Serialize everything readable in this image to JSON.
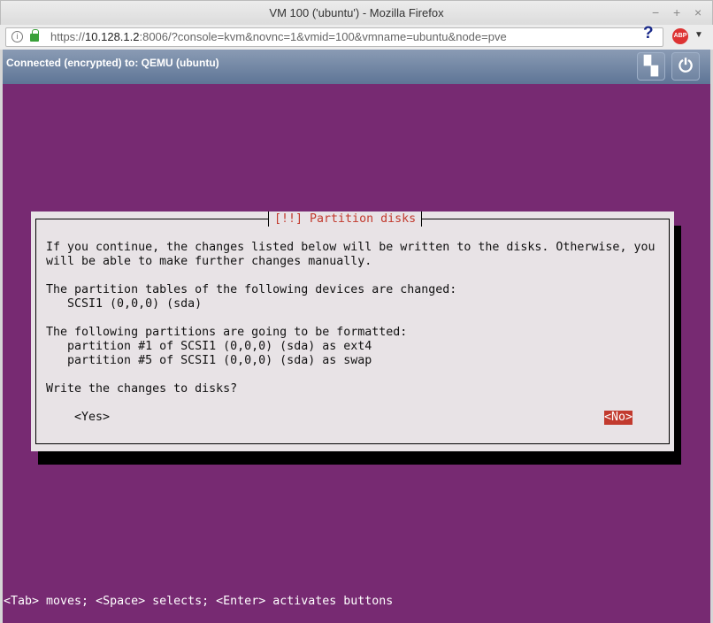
{
  "window": {
    "title": "VM 100 ('ubuntu') - Mozilla Firefox",
    "controls": [
      "−",
      "+",
      "×"
    ]
  },
  "browser": {
    "url_prefix": "https://",
    "url_host": "10.128.1.2",
    "url_rest": ":8006/?console=kvm&novnc=1&vmid=100&vmname=ubuntu&node=pve",
    "abp": "ABP"
  },
  "vnc": {
    "status": "Connected (encrypted) to: QEMU (ubuntu)"
  },
  "dialog": {
    "title": "[!!] Partition disks",
    "body": "If you continue, the changes listed below will be written to the disks. Otherwise, you\nwill be able to make further changes manually.\n\nThe partition tables of the following devices are changed:\n   SCSI1 (0,0,0) (sda)\n\nThe following partitions are going to be formatted:\n   partition #1 of SCSI1 (0,0,0) (sda) as ext4\n   partition #5 of SCSI1 (0,0,0) (sda) as swap\n\nWrite the changes to disks?",
    "yes": "<Yes>",
    "no": "<No>"
  },
  "help_line": "<Tab> moves; <Space> selects; <Enter> activates buttons"
}
